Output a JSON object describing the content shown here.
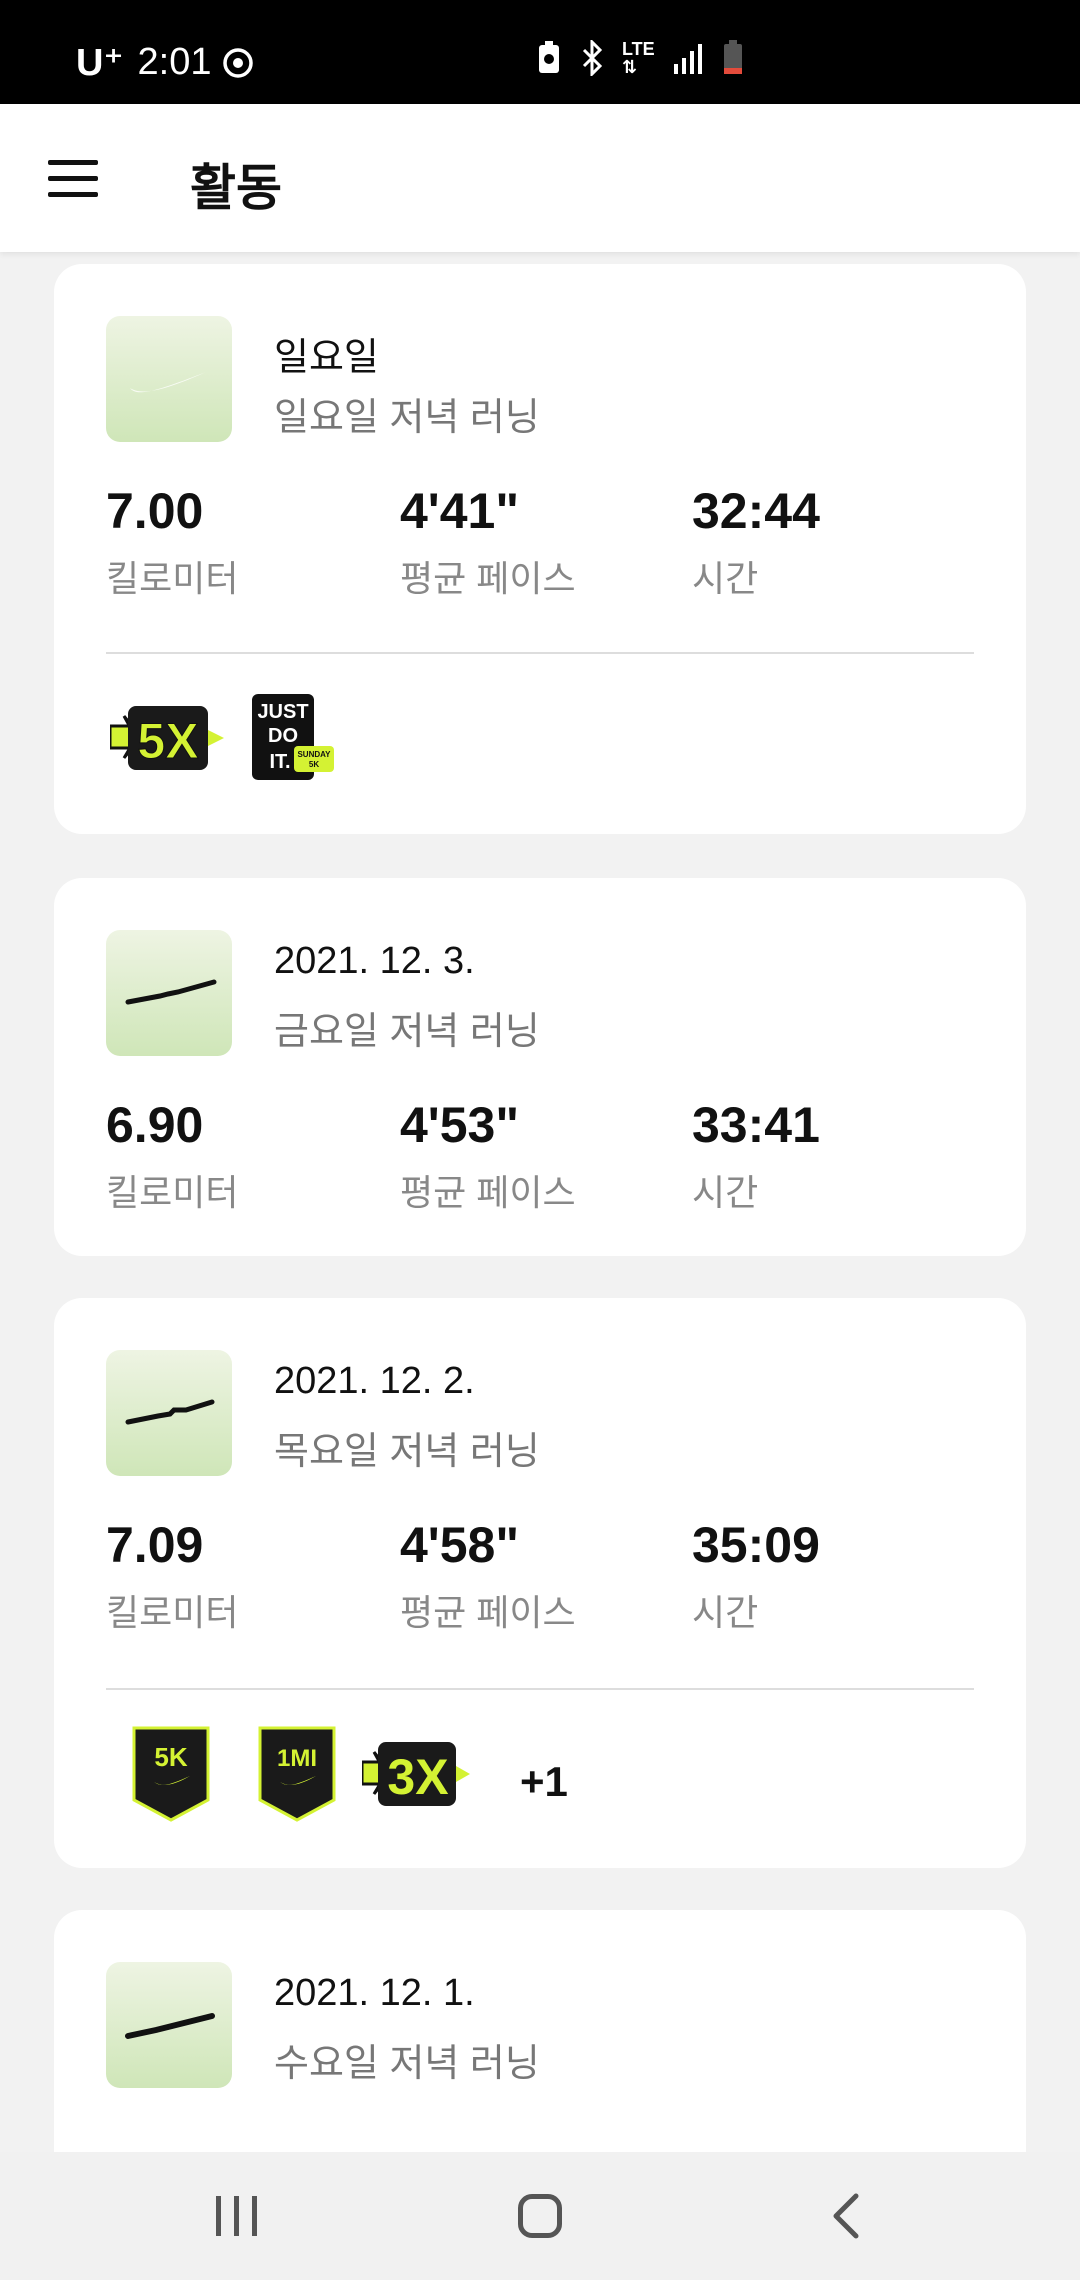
{
  "status_bar": {
    "carrier": "U⁺",
    "time": "2:01",
    "network": "LTE"
  },
  "header": {
    "title": "활동"
  },
  "activities": [
    {
      "title": "일요일",
      "subtitle": "일요일 저녁 러닝",
      "distance": "7.00",
      "distance_label": "킬로미터",
      "pace": "4'41\"",
      "pace_label": "평균 페이스",
      "duration": "32:44",
      "duration_label": "시간",
      "badges": [
        "5X",
        "JUST DO IT."
      ],
      "badge_sub": "SUNDAY 5K"
    },
    {
      "title": "2021. 12. 3.",
      "subtitle": "금요일 저녁 러닝",
      "distance": "6.90",
      "distance_label": "킬로미터",
      "pace": "4'53\"",
      "pace_label": "평균 페이스",
      "duration": "33:41",
      "duration_label": "시간"
    },
    {
      "title": "2021. 12. 2.",
      "subtitle": "목요일 저녁 러닝",
      "distance": "7.09",
      "distance_label": "킬로미터",
      "pace": "4'58\"",
      "pace_label": "평균 페이스",
      "duration": "35:09",
      "duration_label": "시간",
      "badges": [
        "5K",
        "1MI",
        "3X"
      ],
      "more_badges": "+1"
    },
    {
      "title": "2021. 12. 1.",
      "subtitle": "수요일 저녁 러닝"
    }
  ],
  "colors": {
    "badge_yellow": "#d4f233",
    "thumb_green": "#cfe6b8",
    "card_bg": "#ffffff",
    "page_bg": "#f2f2f2"
  }
}
